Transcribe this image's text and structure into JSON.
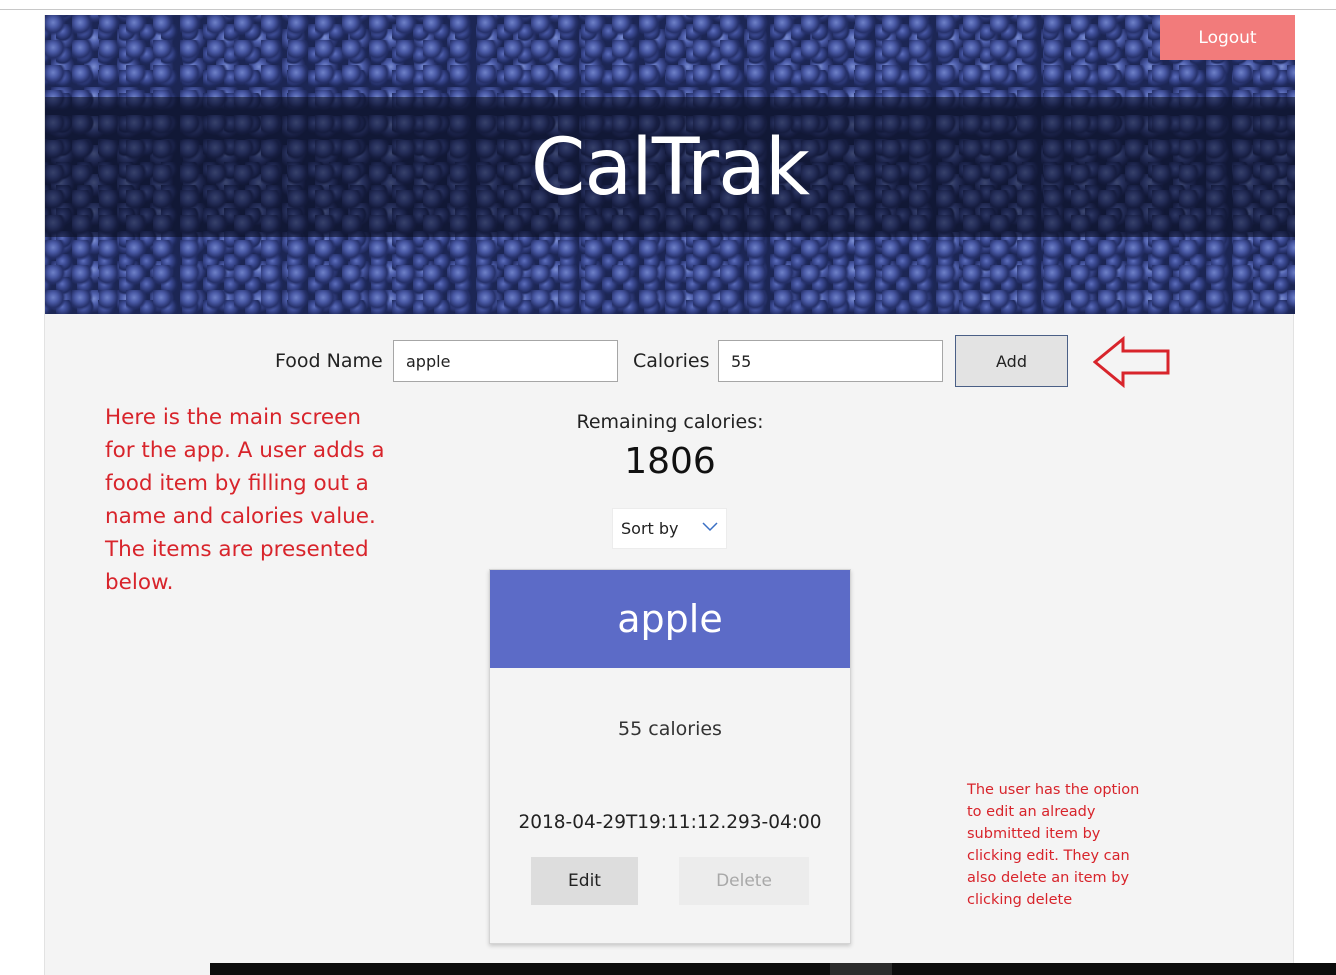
{
  "app": {
    "title": "CalTrak",
    "logout_label": "Logout"
  },
  "form": {
    "food_label": "Food Name",
    "food_value": "apple",
    "calories_label": "Calories",
    "calories_value": "55",
    "add_label": "Add"
  },
  "summary": {
    "remaining_label": "Remaining calories:",
    "remaining_value": "1806"
  },
  "sort": {
    "selected": "Sort by"
  },
  "items": [
    {
      "name": "apple",
      "calories_text": "55 calories",
      "timestamp": "2018-04-29T19:11:12.293-04:00",
      "edit_label": "Edit",
      "delete_label": "Delete"
    }
  ],
  "annotations": {
    "main": "Here is the main screen for the app.  A user adds a food item by filling out a name and calories value.  The items are presented below.",
    "side": "The user has the option to edit an already submitted item by clicking edit.  They can also delete an item by clicking delete"
  },
  "colors": {
    "logout_bg": "#f27b7b",
    "card_header": "#5c6bc7",
    "annotation": "#d8242b",
    "page_bg": "#f4f4f4"
  },
  "icons": {
    "sort_dropdown": "chevron-down-icon",
    "annotation_arrow": "arrow-left-outline-icon"
  }
}
